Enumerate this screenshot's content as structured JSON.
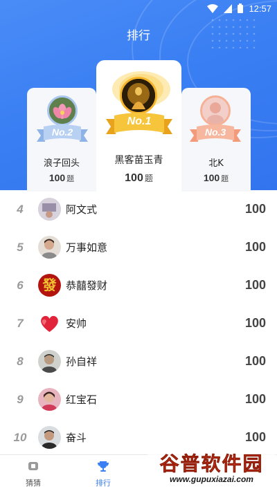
{
  "status_bar": {
    "time": "12:57",
    "icons": [
      "wifi-icon",
      "signal-icon",
      "battery-icon"
    ]
  },
  "header": {
    "title": "排行"
  },
  "podium": {
    "first": {
      "badge": "No.1",
      "name": "黑客苗玉青",
      "score": "100",
      "unit": "题"
    },
    "second": {
      "badge": "No.2",
      "name": "浪子回头",
      "score": "100",
      "unit": "题"
    },
    "third": {
      "badge": "No.3",
      "name": "北K",
      "score": "100",
      "unit": "题"
    }
  },
  "ranking": [
    {
      "rank": "4",
      "name": "阿文式",
      "score": "100"
    },
    {
      "rank": "5",
      "name": "万事如意",
      "score": "100"
    },
    {
      "rank": "6",
      "name": "恭囍發财",
      "score": "100"
    },
    {
      "rank": "7",
      "name": "安帅",
      "score": "100"
    },
    {
      "rank": "8",
      "name": "孙自祥",
      "score": "100"
    },
    {
      "rank": "9",
      "name": "红宝石",
      "score": "100"
    },
    {
      "rank": "10",
      "name": "奋斗",
      "score": "100"
    }
  ],
  "avatar_glyphs": {
    "rank6": "發"
  },
  "bottom_nav": {
    "items": [
      {
        "label": "猜猜",
        "icon": "guess-icon",
        "active": false
      },
      {
        "label": "排行",
        "icon": "trophy-icon",
        "active": true
      }
    ]
  },
  "watermark": {
    "text_cn": "谷普软件园",
    "text_url": "www.gupuxiazai.com"
  },
  "colors": {
    "header_blue": "#3a7ff3",
    "gold": "#f5b52a",
    "silver_blue": "#a9c6ee",
    "bronze": "#f5b095",
    "nav_active": "#3a7ff3",
    "nav_inactive": "#777777",
    "watermark_red": "#e03a1c"
  }
}
